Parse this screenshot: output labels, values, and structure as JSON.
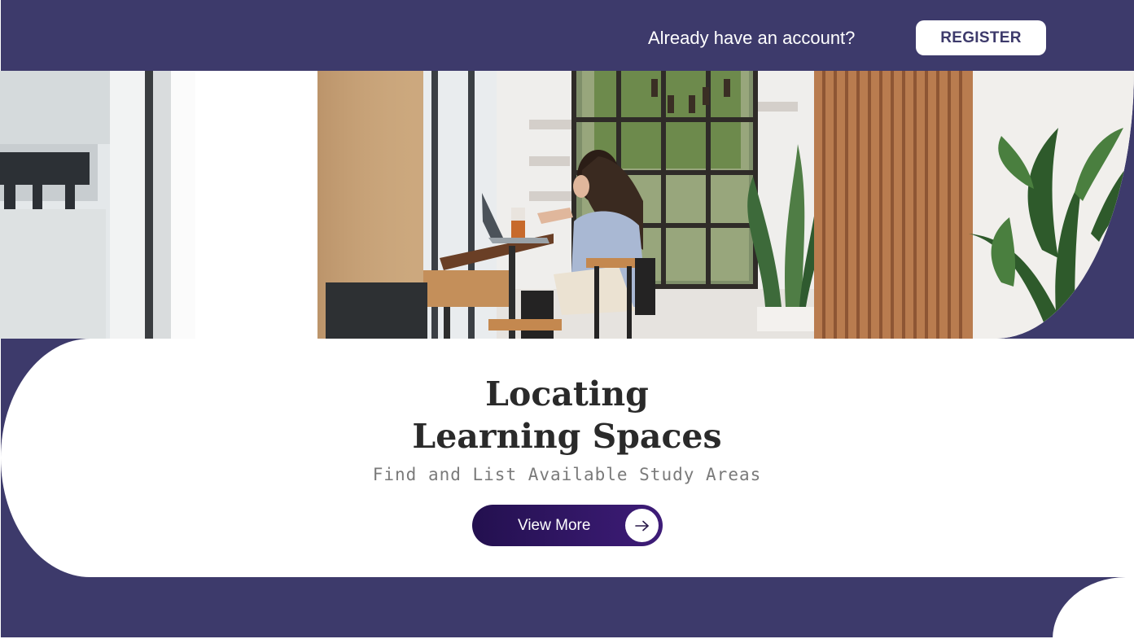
{
  "header": {
    "prompt": "Already have an account?",
    "register_label": "REGISTER"
  },
  "hero": {
    "title_line1": "Locating",
    "title_line2": "Learning Spaces",
    "subtitle": "Find and List Available Study Areas",
    "cta_label": "View More",
    "cta_icon": "arrow-right-icon"
  },
  "colors": {
    "brand": "#3d3a6b",
    "button_gradient_start": "#23104f",
    "button_gradient_end": "#3e1c78",
    "title": "#2a2a2a",
    "subtitle": "#7a7a7a"
  }
}
